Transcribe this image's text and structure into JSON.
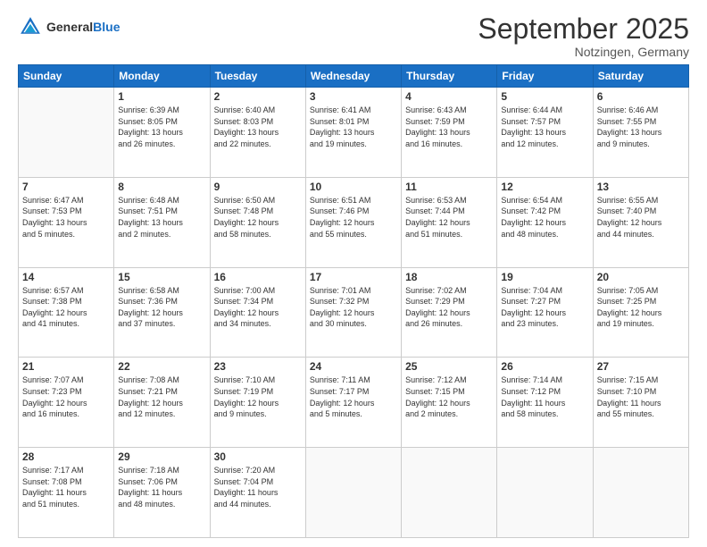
{
  "header": {
    "logo_text_general": "General",
    "logo_text_blue": "Blue",
    "month_title": "September 2025",
    "location": "Notzingen, Germany"
  },
  "weekdays": [
    "Sunday",
    "Monday",
    "Tuesday",
    "Wednesday",
    "Thursday",
    "Friday",
    "Saturday"
  ],
  "weeks": [
    [
      {
        "day": "",
        "info": ""
      },
      {
        "day": "1",
        "info": "Sunrise: 6:39 AM\nSunset: 8:05 PM\nDaylight: 13 hours\nand 26 minutes."
      },
      {
        "day": "2",
        "info": "Sunrise: 6:40 AM\nSunset: 8:03 PM\nDaylight: 13 hours\nand 22 minutes."
      },
      {
        "day": "3",
        "info": "Sunrise: 6:41 AM\nSunset: 8:01 PM\nDaylight: 13 hours\nand 19 minutes."
      },
      {
        "day": "4",
        "info": "Sunrise: 6:43 AM\nSunset: 7:59 PM\nDaylight: 13 hours\nand 16 minutes."
      },
      {
        "day": "5",
        "info": "Sunrise: 6:44 AM\nSunset: 7:57 PM\nDaylight: 13 hours\nand 12 minutes."
      },
      {
        "day": "6",
        "info": "Sunrise: 6:46 AM\nSunset: 7:55 PM\nDaylight: 13 hours\nand 9 minutes."
      }
    ],
    [
      {
        "day": "7",
        "info": "Sunrise: 6:47 AM\nSunset: 7:53 PM\nDaylight: 13 hours\nand 5 minutes."
      },
      {
        "day": "8",
        "info": "Sunrise: 6:48 AM\nSunset: 7:51 PM\nDaylight: 13 hours\nand 2 minutes."
      },
      {
        "day": "9",
        "info": "Sunrise: 6:50 AM\nSunset: 7:48 PM\nDaylight: 12 hours\nand 58 minutes."
      },
      {
        "day": "10",
        "info": "Sunrise: 6:51 AM\nSunset: 7:46 PM\nDaylight: 12 hours\nand 55 minutes."
      },
      {
        "day": "11",
        "info": "Sunrise: 6:53 AM\nSunset: 7:44 PM\nDaylight: 12 hours\nand 51 minutes."
      },
      {
        "day": "12",
        "info": "Sunrise: 6:54 AM\nSunset: 7:42 PM\nDaylight: 12 hours\nand 48 minutes."
      },
      {
        "day": "13",
        "info": "Sunrise: 6:55 AM\nSunset: 7:40 PM\nDaylight: 12 hours\nand 44 minutes."
      }
    ],
    [
      {
        "day": "14",
        "info": "Sunrise: 6:57 AM\nSunset: 7:38 PM\nDaylight: 12 hours\nand 41 minutes."
      },
      {
        "day": "15",
        "info": "Sunrise: 6:58 AM\nSunset: 7:36 PM\nDaylight: 12 hours\nand 37 minutes."
      },
      {
        "day": "16",
        "info": "Sunrise: 7:00 AM\nSunset: 7:34 PM\nDaylight: 12 hours\nand 34 minutes."
      },
      {
        "day": "17",
        "info": "Sunrise: 7:01 AM\nSunset: 7:32 PM\nDaylight: 12 hours\nand 30 minutes."
      },
      {
        "day": "18",
        "info": "Sunrise: 7:02 AM\nSunset: 7:29 PM\nDaylight: 12 hours\nand 26 minutes."
      },
      {
        "day": "19",
        "info": "Sunrise: 7:04 AM\nSunset: 7:27 PM\nDaylight: 12 hours\nand 23 minutes."
      },
      {
        "day": "20",
        "info": "Sunrise: 7:05 AM\nSunset: 7:25 PM\nDaylight: 12 hours\nand 19 minutes."
      }
    ],
    [
      {
        "day": "21",
        "info": "Sunrise: 7:07 AM\nSunset: 7:23 PM\nDaylight: 12 hours\nand 16 minutes."
      },
      {
        "day": "22",
        "info": "Sunrise: 7:08 AM\nSunset: 7:21 PM\nDaylight: 12 hours\nand 12 minutes."
      },
      {
        "day": "23",
        "info": "Sunrise: 7:10 AM\nSunset: 7:19 PM\nDaylight: 12 hours\nand 9 minutes."
      },
      {
        "day": "24",
        "info": "Sunrise: 7:11 AM\nSunset: 7:17 PM\nDaylight: 12 hours\nand 5 minutes."
      },
      {
        "day": "25",
        "info": "Sunrise: 7:12 AM\nSunset: 7:15 PM\nDaylight: 12 hours\nand 2 minutes."
      },
      {
        "day": "26",
        "info": "Sunrise: 7:14 AM\nSunset: 7:12 PM\nDaylight: 11 hours\nand 58 minutes."
      },
      {
        "day": "27",
        "info": "Sunrise: 7:15 AM\nSunset: 7:10 PM\nDaylight: 11 hours\nand 55 minutes."
      }
    ],
    [
      {
        "day": "28",
        "info": "Sunrise: 7:17 AM\nSunset: 7:08 PM\nDaylight: 11 hours\nand 51 minutes."
      },
      {
        "day": "29",
        "info": "Sunrise: 7:18 AM\nSunset: 7:06 PM\nDaylight: 11 hours\nand 48 minutes."
      },
      {
        "day": "30",
        "info": "Sunrise: 7:20 AM\nSunset: 7:04 PM\nDaylight: 11 hours\nand 44 minutes."
      },
      {
        "day": "",
        "info": ""
      },
      {
        "day": "",
        "info": ""
      },
      {
        "day": "",
        "info": ""
      },
      {
        "day": "",
        "info": ""
      }
    ]
  ]
}
